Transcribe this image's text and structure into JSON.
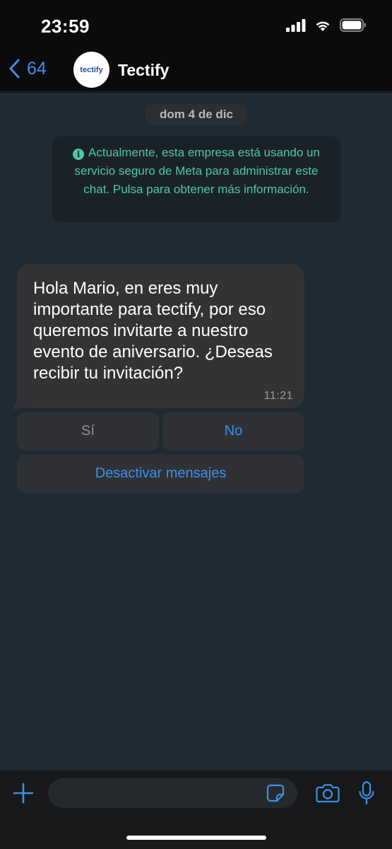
{
  "status_bar": {
    "time": "23:59"
  },
  "header": {
    "back_count": "64",
    "avatar_text": "tectify",
    "contact_name": "Tectify"
  },
  "chat": {
    "date": "dom 4 de dic",
    "info_text": "Actualmente, esta empresa está usando un servicio seguro de Meta para administrar este chat. Pulsa para obtener más información.",
    "message": {
      "lines": [
        "Hola Mario, en eres muy",
        "importante para tectify, por eso",
        "queremos invitarte a nuestro",
        "evento de aniversario. ¿Deseas",
        "recibir tu invitación?"
      ],
      "time": "11:21"
    },
    "quick_replies": {
      "yes": "Sí",
      "no": "No",
      "unsubscribe": "Desactivar mensajes"
    }
  },
  "colors": {
    "accent": "#3d8fe8",
    "info_text": "#50c6ad",
    "chat_background": "#1f2a33",
    "bubble": "#333336"
  },
  "icons": [
    "chevron-left-icon",
    "plus-icon",
    "sticker-icon",
    "camera-icon",
    "microphone-icon",
    "signal-icon",
    "wifi-icon",
    "battery-icon",
    "info-icon"
  ]
}
